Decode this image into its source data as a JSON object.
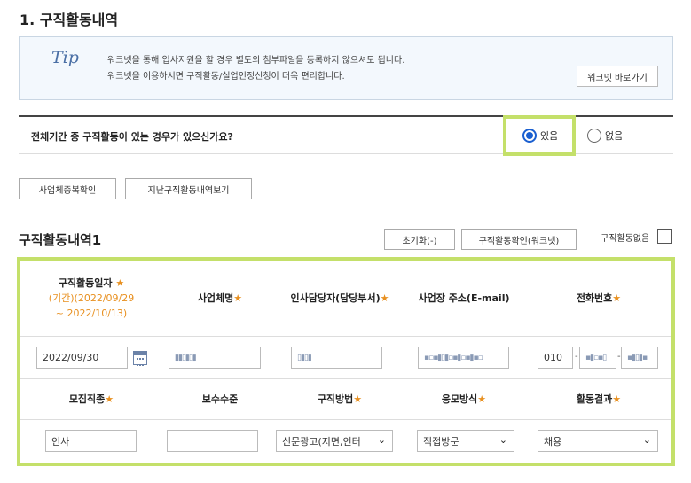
{
  "section_title": "1. 구직활동내역",
  "tip": {
    "logo": "Tip",
    "line1": "워크넷을 통해 입사지원을 할 경우 별도의 첨부파일을 등록하지 않으셔도 됩니다.",
    "line2": "워크넷을 이용하시면 구직활동/실업인정신청이 더욱 편리합니다.",
    "button": "워크넷 바로가기"
  },
  "question": {
    "label": "전체기간 중 구직활동이 있는 경우가 있으신가요?",
    "options": [
      "있음",
      "없음"
    ],
    "selected": "있음"
  },
  "buttons": {
    "duplicate_check": "사업체중복확인",
    "past_history": "지난구직활동내역보기"
  },
  "record": {
    "title": "구직활동내역1",
    "reset": "초기화(-)",
    "confirm": "구직활동확인(워크넷)",
    "no_activity": "구직활동없음",
    "headers1": {
      "date": "구직활동일자",
      "period1": "(기간)(2022/09/29",
      "period2": "~ 2022/10/13)",
      "company": "사업체명",
      "manager": "인사담당자(담당부서)",
      "address": "사업장 주소(E-mail)",
      "phone": "전화번호"
    },
    "headers2": {
      "job": "모집직종",
      "salary": "보수수준",
      "method": "구직방법",
      "apply": "응모방식",
      "result": "활동결과"
    },
    "values": {
      "date": "2022/09/30",
      "company": "▮▮▯▮▯▮",
      "manager": "▯▮▯▮",
      "email": "▪▫▪▮▯▮▫▪▮▫▪▮▪▫",
      "phone1": "010",
      "phone2": "▪▮▫▪▯",
      "phone3": "▪▮▯▮▪",
      "job": "인사",
      "salary": "",
      "method": "신문광고(지면,인터",
      "apply": "직접방문",
      "result": "채용"
    },
    "star": "★",
    "colors": {
      "highlight": "#c4e06a",
      "required": "#e89020",
      "radio": "#1a5fd0"
    }
  }
}
